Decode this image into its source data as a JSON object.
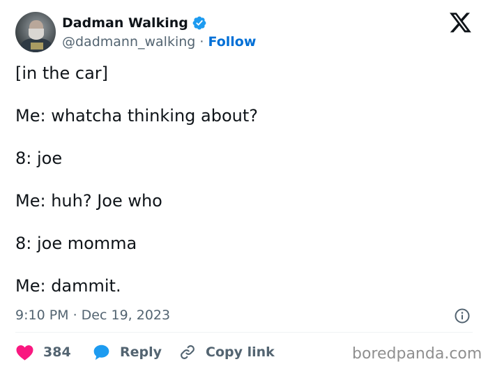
{
  "author": {
    "name": "Dadman Walking",
    "handle": "@dadmann_walking",
    "separator": "·",
    "follow_label": "Follow",
    "verified_color": "#1d9bf0"
  },
  "tweet": {
    "lines": [
      "[in the car]",
      "Me: whatcha thinking about?",
      "8: joe",
      "Me: huh? Joe who",
      "8: joe momma",
      "Me: dammit."
    ],
    "timestamp": "9:10 PM · Dec 19, 2023"
  },
  "actions": {
    "likes": "384",
    "reply_label": "Reply",
    "copy_link_label": "Copy link",
    "like_color": "#f91880",
    "reply_color": "#1d9bf0"
  },
  "icons": [
    "avatar",
    "verified-badge-icon",
    "x-logo-icon",
    "info-icon",
    "heart-icon",
    "reply-bubble-icon",
    "link-icon"
  ],
  "watermark": "boredpanda.com"
}
